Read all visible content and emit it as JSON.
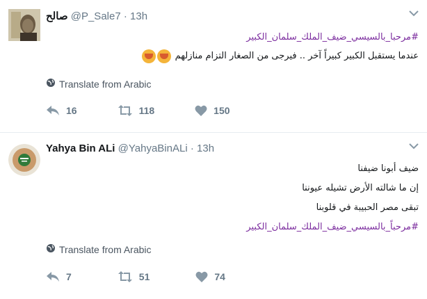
{
  "tweets": [
    {
      "name": "صالح",
      "handle": "@P_Sale7",
      "dot": "·",
      "time": "13h",
      "lines": [
        {
          "text": "#مرحبا_بالسيسي_ضيف_الملك_سلمان_الكبير",
          "hashtag": true
        },
        {
          "text": "عندما يستقبل الكبير كبيراً آخر .. فيرجى من الصغار التزام منازلهم",
          "hashtag": false,
          "emoji": 2
        }
      ],
      "translate": "Translate from Arabic",
      "reply_count": "16",
      "retweet_count": "118",
      "like_count": "150"
    },
    {
      "name": "Yahya Bin ALi",
      "handle": "@YahyaBinALi",
      "dot": "·",
      "time": "13h",
      "lines": [
        {
          "text": "ضيف أبونا ضيفنا",
          "hashtag": false
        },
        {
          "text": "إن ما شالته الأرض تشيله عيوننا",
          "hashtag": false
        },
        {
          "text": "تبقى مصر الحبيبة في قلوبنا",
          "hashtag": false
        },
        {
          "text": "#مرحباً_بالسيسي_ضيف_الملك_سلمان_الكبير",
          "hashtag": true
        }
      ],
      "translate": "Translate from Arabic",
      "reply_count": "7",
      "retweet_count": "51",
      "like_count": "74"
    }
  ],
  "icons": [
    "globe-icon",
    "reply-icon",
    "retweet-icon",
    "like-icon",
    "caret-down-icon"
  ],
  "colors": {
    "hashtag": "#7b2c9e",
    "muted": "#657786",
    "divider": "#e6ecf0"
  }
}
